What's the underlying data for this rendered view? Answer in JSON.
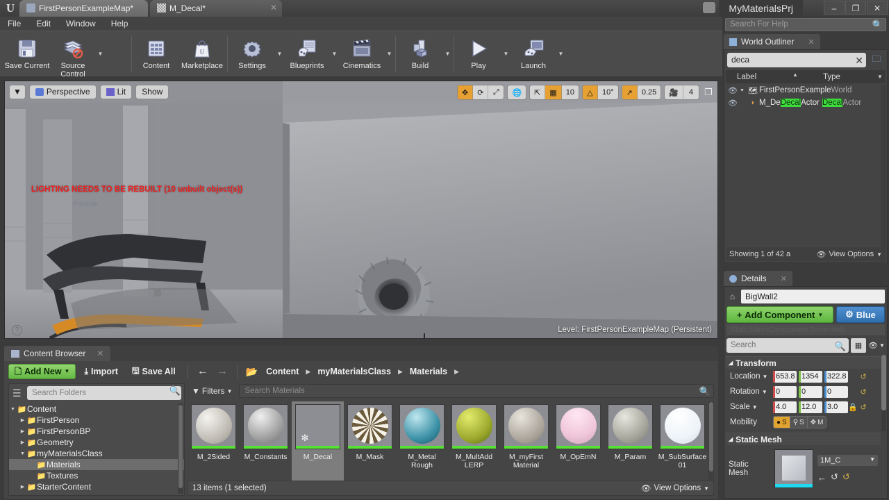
{
  "window": {
    "project_title": "MyMaterialsPrj",
    "minimize": "–",
    "maximize": "❐",
    "close": "✕",
    "logo": "U"
  },
  "tabs": [
    {
      "label": "FirstPersonExampleMap*",
      "icon": "map-icon",
      "active": true
    },
    {
      "label": "M_Decal*",
      "icon": "material-icon",
      "active": false
    }
  ],
  "menu": {
    "items": [
      "File",
      "Edit",
      "Window",
      "Help"
    ]
  },
  "help_search": {
    "placeholder": "Search For Help",
    "value": ""
  },
  "toolbar": {
    "groups": [
      {
        "items": [
          {
            "label": "Save Current",
            "icon": "floppy-disk-icon",
            "arrow": false
          },
          {
            "label": "Source Control",
            "icon": "source-control-icon",
            "arrow": true
          }
        ]
      },
      {
        "items": [
          {
            "label": "Content",
            "icon": "content-grid-icon",
            "arrow": false
          },
          {
            "label": "Marketplace",
            "icon": "shopping-bag-icon",
            "arrow": false
          }
        ]
      },
      {
        "items": [
          {
            "label": "Settings",
            "icon": "gear-icon",
            "arrow": true
          },
          {
            "label": "Blueprints",
            "icon": "blueprint-icon",
            "arrow": true
          },
          {
            "label": "Cinematics",
            "icon": "clapperboard-icon",
            "arrow": true
          }
        ]
      },
      {
        "items": [
          {
            "label": "Build",
            "icon": "build-icon",
            "arrow": true
          }
        ]
      },
      {
        "items": [
          {
            "label": "Play",
            "icon": "play-icon",
            "arrow": true
          },
          {
            "label": "Launch",
            "icon": "launch-icon",
            "arrow": true
          }
        ]
      }
    ]
  },
  "viewport": {
    "menu_arrow": "▼",
    "perspective": "Perspective",
    "lit": "Lit",
    "show": "Show",
    "warning": "LIGHTING NEEDS TO BE REBUILT (10 unbuilt object(s))",
    "sub_hint": "Preview",
    "level_text": "Level:  FirstPersonExampleMap (Persistent)",
    "help_glyph": "?",
    "controls": {
      "transform_modes": [
        "move",
        "rotate",
        "scale"
      ],
      "transform_active": "move",
      "world_space": "globe-icon",
      "surface_snap": "surface-snap-icon",
      "grid_snap_on": true,
      "grid_value": "10",
      "angle_snap_on": true,
      "angle_value": "10°",
      "scale_snap_on": true,
      "scale_value": "0.25",
      "camera_speed": "4",
      "maximize_icon": "maximize-viewport-icon"
    }
  },
  "content_browser": {
    "tab_label": "Content Browser",
    "tab_close": "✕",
    "add_new": "Add New",
    "import": "Import",
    "save_all": "Save All",
    "breadcrumb": [
      "Content",
      "myMaterialsClass",
      "Materials"
    ],
    "folder_search_placeholder": "Search Folders",
    "filters_label": "Filters",
    "asset_search_placeholder": "Search Materials",
    "status": "13 items (1 selected)",
    "view_options": "View Options",
    "tree": [
      {
        "label": "Content",
        "depth": 0,
        "expanded": true,
        "has_children": true,
        "selected": false
      },
      {
        "label": "FirstPerson",
        "depth": 1,
        "expanded": false,
        "has_children": true,
        "selected": false
      },
      {
        "label": "FirstPersonBP",
        "depth": 1,
        "expanded": false,
        "has_children": true,
        "selected": false
      },
      {
        "label": "Geometry",
        "depth": 1,
        "expanded": false,
        "has_children": true,
        "selected": false
      },
      {
        "label": "myMaterialsClass",
        "depth": 1,
        "expanded": true,
        "has_children": true,
        "selected": false
      },
      {
        "label": "Materials",
        "depth": 2,
        "expanded": false,
        "has_children": false,
        "selected": true
      },
      {
        "label": "Textures",
        "depth": 2,
        "expanded": false,
        "has_children": false,
        "selected": false
      },
      {
        "label": "StarterContent",
        "depth": 1,
        "expanded": false,
        "has_children": true,
        "selected": false
      }
    ],
    "assets": [
      {
        "label": "M_2Sided",
        "kind": "material",
        "selected": false,
        "color_a": "#f0eeea",
        "color_b": "#b9b5ad"
      },
      {
        "label": "M_Constants",
        "kind": "material",
        "selected": false,
        "color_a": "#e3e3e3",
        "color_b": "#8c8c8c"
      },
      {
        "label": "M_Decal",
        "kind": "material",
        "selected": true,
        "color_a": "#cfcfcf",
        "color_b": "#a8a8a8"
      },
      {
        "label": "M_Mask",
        "kind": "material",
        "selected": false,
        "color_a": "#f4efe4",
        "color_b": "#6b5b3c"
      },
      {
        "label": "M_Metal Rough",
        "kind": "material",
        "selected": false,
        "color_a": "#9cd6e0",
        "color_b": "#1d6e80"
      },
      {
        "label": "M_MultAdd LERP",
        "kind": "material",
        "selected": false,
        "color_a": "#d6e04f",
        "color_b": "#6c7a1e"
      },
      {
        "label": "M_myFirst Material",
        "kind": "material",
        "selected": false,
        "color_a": "#dedad2",
        "color_b": "#9a948a"
      },
      {
        "label": "M_OpEmN",
        "kind": "material",
        "selected": false,
        "color_a": "#ffd9ea",
        "color_b": "#d8a6bd"
      },
      {
        "label": "M_Param",
        "kind": "material",
        "selected": false,
        "color_a": "#dbdbd4",
        "color_b": "#8f8f86"
      },
      {
        "label": "M_SubSurface 01",
        "kind": "material",
        "selected": false,
        "color_a": "#ffffff",
        "color_b": "#d6dee6"
      }
    ]
  },
  "world_outliner": {
    "tab_label": "World Outliner",
    "tab_close": "✕",
    "search_value": "deca",
    "clear_glyph": "✕",
    "col_label": "Label",
    "col_type": "Type",
    "rows": [
      {
        "label_pre": "FirstPersonExample",
        "label_hl": "",
        "label_post": "",
        "type_pre": "World",
        "type_hl": "",
        "type_post": "",
        "depth": 0,
        "icon": "level-icon"
      },
      {
        "label_pre": "M_De",
        "label_hl": "Decal",
        "label_post": "Actor",
        "type_pre": "",
        "type_hl": "Decal",
        "type_post": "Actor",
        "depth": 1,
        "icon": "decal-icon"
      }
    ],
    "footer_count": "Showing 1 of 42 a",
    "footer_view_options": "View Options"
  },
  "details": {
    "tab_label": "Details",
    "tab_close": "✕",
    "actor_name": "BigWall2",
    "add_component": "Add Component",
    "blueprint_button": "Blue",
    "component_row": "StaticMeshComponent (Inherited)",
    "search_placeholder": "Search",
    "transform": {
      "section": "Transform",
      "location": {
        "label": "Location",
        "x": "653.8",
        "y": "1354",
        "z": "322.8"
      },
      "rotation": {
        "label": "Rotation",
        "x": "0",
        "y": "0",
        "z": "0"
      },
      "scale": {
        "label": "Scale",
        "x": "4.0",
        "y": "12.0",
        "z": "3.0"
      },
      "mobility": {
        "label": "Mobility",
        "options": [
          "Static",
          "Stationary",
          "Movable"
        ],
        "selected": "Static"
      }
    },
    "static_mesh": {
      "section": "Static Mesh",
      "label": "Static Mesh",
      "asset_name": "1M_C"
    }
  },
  "colors": {
    "accent_orange": "#e2a431",
    "green": "#5fb63f",
    "blue": "#2f6fae",
    "warning_red": "#f02020",
    "highlight_green": "#3ddc3d"
  }
}
